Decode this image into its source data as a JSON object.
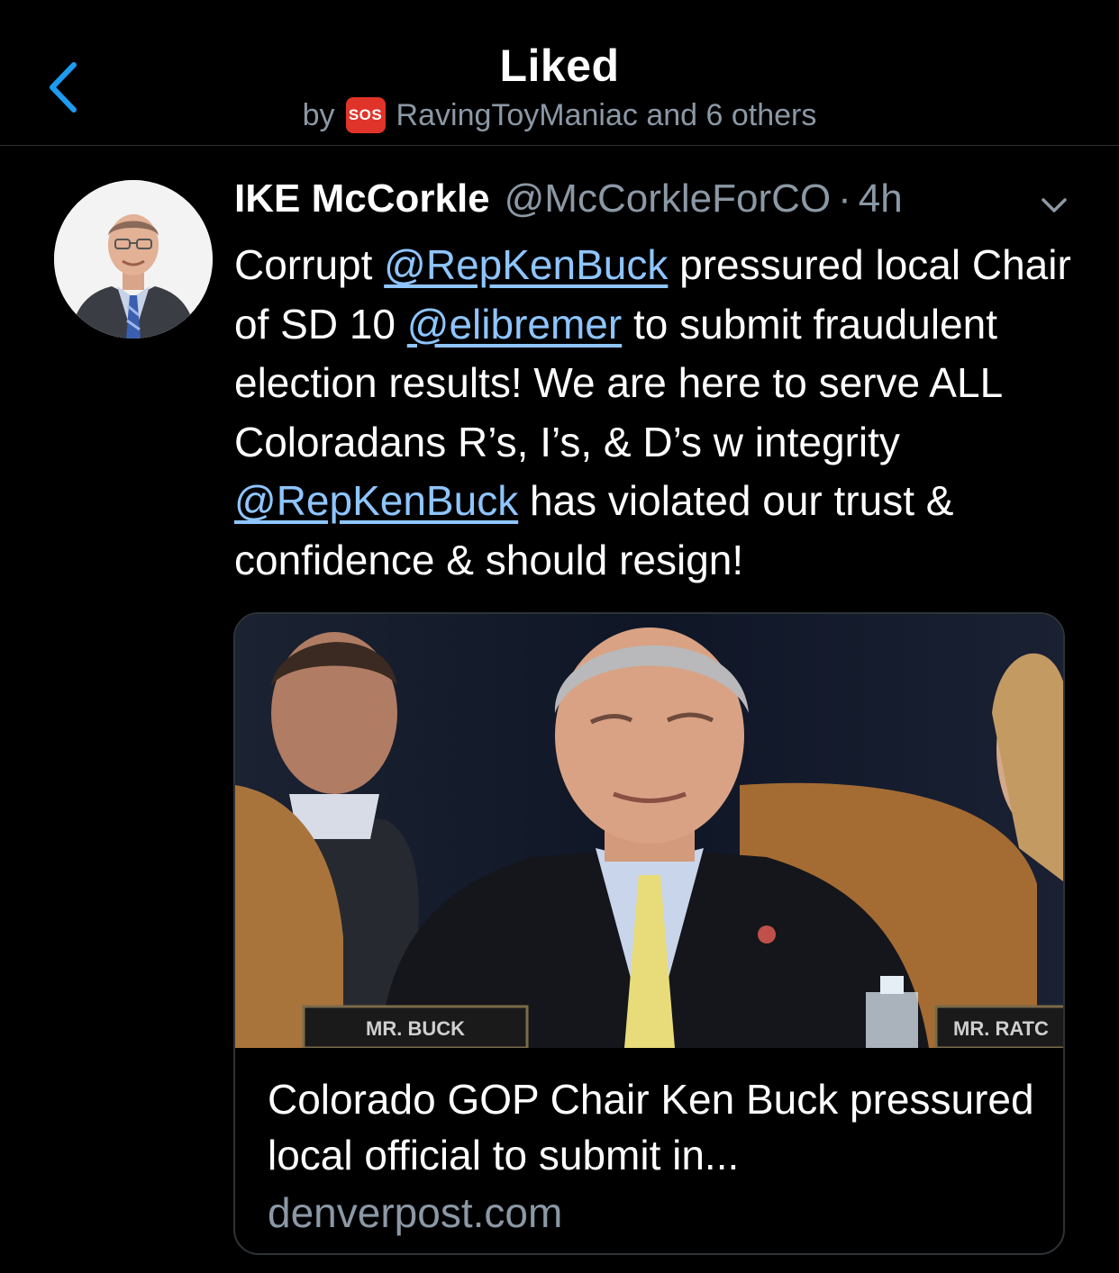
{
  "header": {
    "title": "Liked",
    "by_prefix": "by",
    "badge": "SOS",
    "liked_by": "RavingToyManiac and 6 others"
  },
  "tweet": {
    "author_name": "IKE McCorkle",
    "author_handle": "@McCorkleForCO",
    "time": "4h",
    "text_1": "Corrupt ",
    "mention_1": "@RepKenBuck",
    "text_2": " pressured local Chair of SD 10 ",
    "mention_2": "@elibremer",
    "text_3": " to submit fraudulent election results! We are here to serve ALL Coloradans R’s, I’s, & D’s w integrity ",
    "mention_3": "@RepKenBuck",
    "text_4": " has violated our trust & confidence & should resign!"
  },
  "card": {
    "placard_left": "MR. BUCK",
    "placard_right": "MR. RATC",
    "title": "Colorado GOP Chair Ken Buck pressured local official to submit in...",
    "domain": "denverpost.com"
  },
  "colors": {
    "background": "#000000",
    "link": "#8ec5ff",
    "muted": "#8b98a5",
    "accent": "#1d9bf0",
    "divider": "#2f3336"
  },
  "icons": {
    "back": "chevron-left-icon",
    "more": "chevron-down-icon",
    "badge": "sos-icon"
  }
}
